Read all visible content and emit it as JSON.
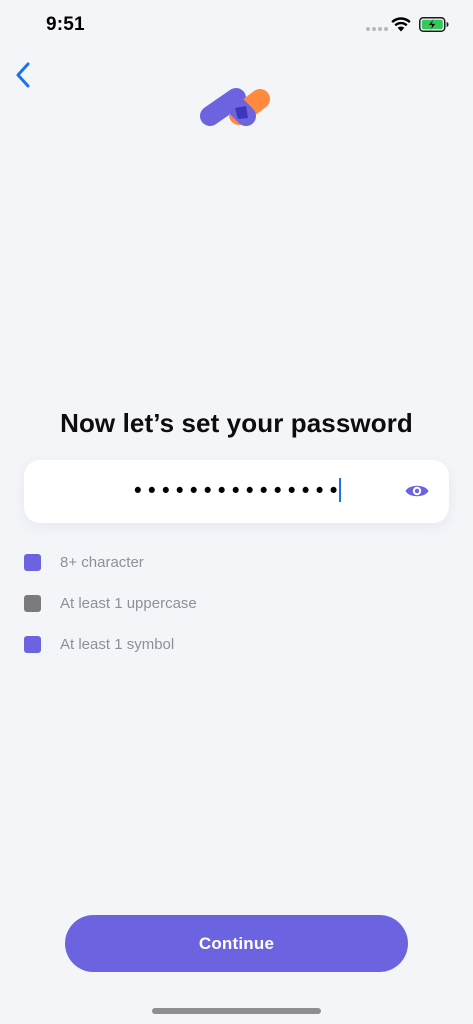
{
  "status_bar": {
    "time": "9:51"
  },
  "navigation": {
    "back_icon": "chevron-left-icon"
  },
  "logo": {
    "icon": "app-logo-icon",
    "colors": {
      "purple": "#6c63e0",
      "dark": "#3e35b8",
      "orange": "#ff8a3d"
    }
  },
  "title": "Now let’s set your password",
  "password_field": {
    "value": "•••••••••••••••",
    "toggle_icon": "eye-icon"
  },
  "requirements": [
    {
      "label": "8+ character",
      "met": true,
      "color": "#6c63e0"
    },
    {
      "label": "At least 1 uppercase",
      "met": false,
      "color": "#7b7b7e"
    },
    {
      "label": "At least 1 symbol",
      "met": true,
      "color": "#6c63e0"
    }
  ],
  "continue_button": {
    "label": "Continue",
    "color": "#6c63e0"
  },
  "colors": {
    "background": "#f4f5f9",
    "accent": "#6c63e0",
    "link": "#1a73e8"
  }
}
